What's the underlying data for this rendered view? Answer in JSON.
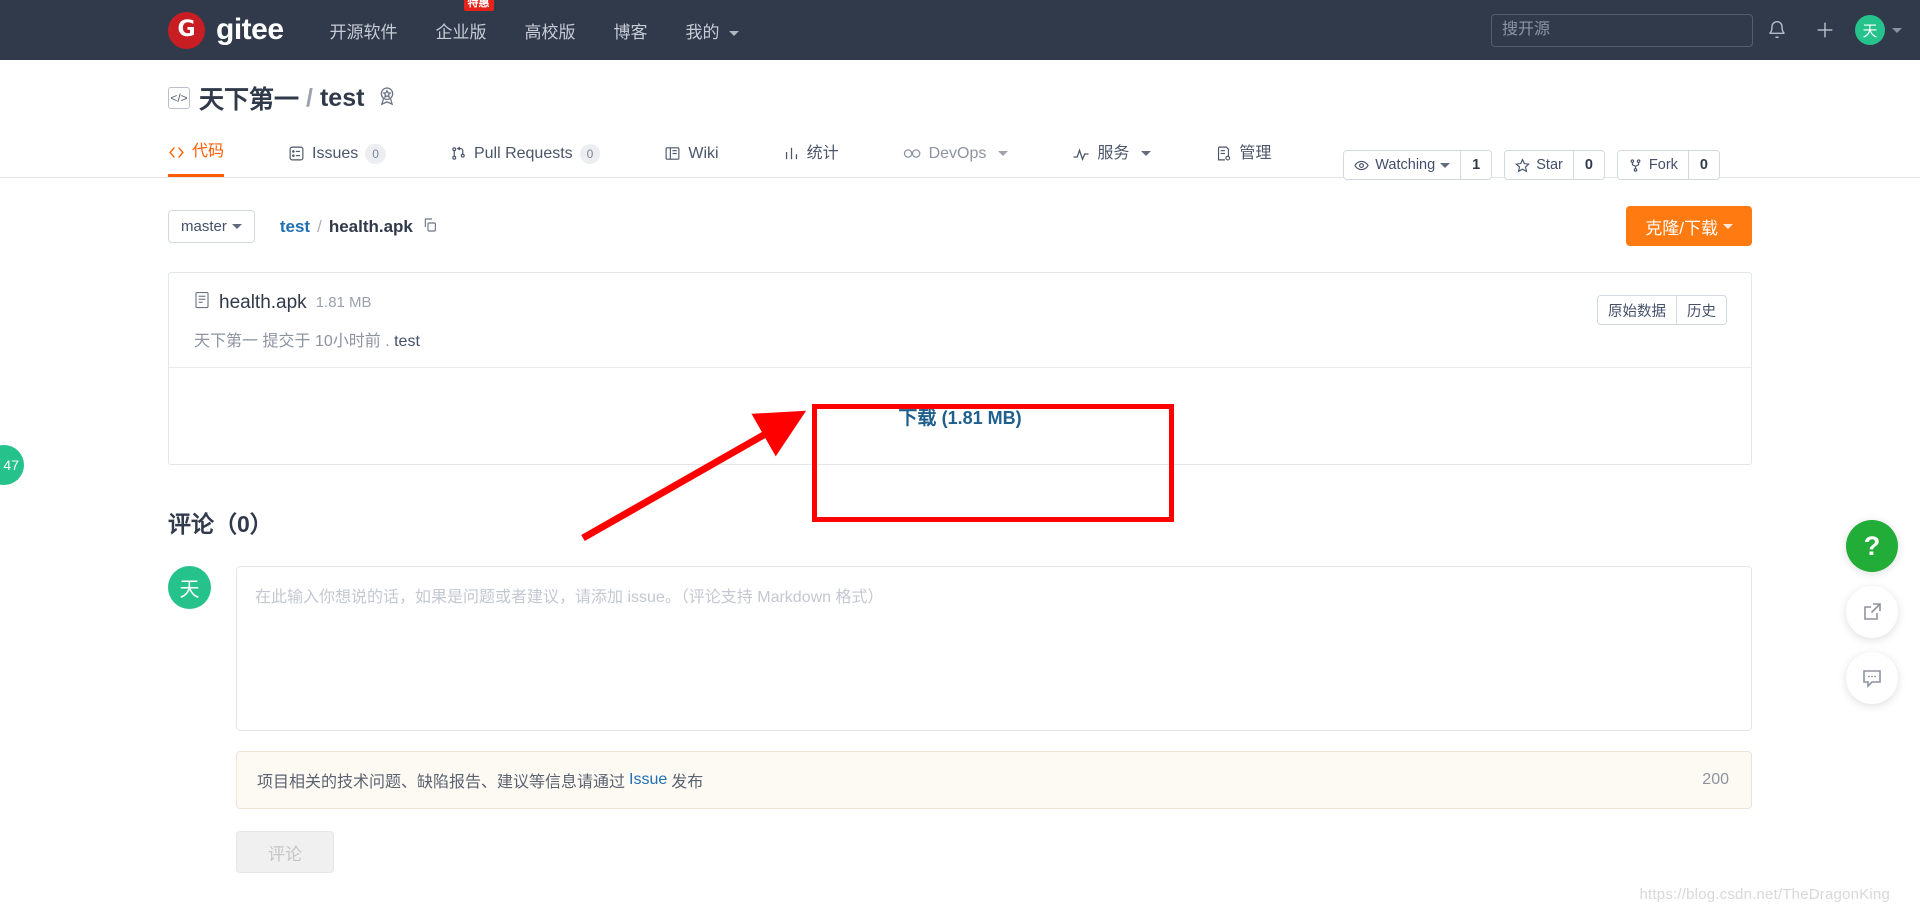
{
  "topnav": {
    "brand": "gitee",
    "brand_mark": "G",
    "links": [
      {
        "label": "开源软件",
        "badge": ""
      },
      {
        "label": "企业版",
        "badge": "特惠"
      },
      {
        "label": "高校版",
        "badge": ""
      },
      {
        "label": "博客",
        "badge": ""
      },
      {
        "label": "我的",
        "badge": "",
        "caret": true
      }
    ],
    "search_placeholder": "搜开源",
    "search_value": "",
    "bell_icon": "bell-icon",
    "plus_icon": "plus-icon",
    "avatar_initial": "天"
  },
  "repo": {
    "code_icon": "code-brackets-icon",
    "owner": "天下第一",
    "separator": "/",
    "name": "test",
    "medal_icon": "medal-star-icon",
    "actions": [
      {
        "icon": "eye-icon",
        "label": "Watching",
        "caret": true,
        "count": "1"
      },
      {
        "icon": "star-icon",
        "label": "Star",
        "caret": false,
        "count": "0"
      },
      {
        "icon": "fork-icon",
        "label": "Fork",
        "caret": false,
        "count": "0"
      }
    ]
  },
  "tabs": [
    {
      "icon": "code-icon",
      "label": "代码",
      "badge": "",
      "active": true,
      "caret": false,
      "muted": false
    },
    {
      "icon": "issues-icon",
      "label": "Issues",
      "badge": "0",
      "active": false,
      "caret": false,
      "muted": false
    },
    {
      "icon": "pull-request-icon",
      "label": "Pull Requests",
      "badge": "0",
      "active": false,
      "caret": false,
      "muted": false
    },
    {
      "icon": "wiki-icon",
      "label": "Wiki",
      "badge": "",
      "active": false,
      "caret": false,
      "muted": false
    },
    {
      "icon": "stats-icon",
      "label": "统计",
      "badge": "",
      "active": false,
      "caret": false,
      "muted": false
    },
    {
      "icon": "devops-icon",
      "label": "DevOps",
      "badge": "",
      "active": false,
      "caret": true,
      "muted": true
    },
    {
      "icon": "service-icon",
      "label": "服务",
      "badge": "",
      "active": false,
      "caret": true,
      "muted": false
    },
    {
      "icon": "manage-icon",
      "label": "管理",
      "badge": "",
      "active": false,
      "caret": false,
      "muted": false
    }
  ],
  "toolbar": {
    "branch": "master",
    "breadcrumb_repo": "test",
    "breadcrumb_sep": "/",
    "breadcrumb_file": "health.apk",
    "copy_icon": "copy-icon",
    "clone_label": "克隆/下载"
  },
  "file": {
    "file_icon": "file-icon",
    "name": "health.apk",
    "size": "1.81 MB",
    "commit_author": "天下第一",
    "commit_verb": "提交于",
    "commit_time": "10小时前",
    "commit_dot": ".",
    "commit_message": "test",
    "actions": [
      "原始数据",
      "历史"
    ],
    "download_label": "下载",
    "download_size": "(1.81 MB)"
  },
  "annotation": {
    "box_color": "#fe0000",
    "arrow_color": "#fe0000"
  },
  "comments": {
    "title": "评论（0）",
    "avatar_initial": "天",
    "input_placeholder": "在此输入你想说的话，如果是问题或者建议，请添加 issue。（评论支持 Markdown 格式）",
    "input_value": "",
    "notice_prefix": "项目相关的技术问题、缺陷报告、建议等信息请通过",
    "notice_link": "Issue",
    "notice_suffix": "发布",
    "notice_count": "200",
    "submit_label": "评论"
  },
  "floaters": [
    {
      "icon": "help-question-icon",
      "label": "?"
    },
    {
      "icon": "share-external-icon",
      "label": ""
    },
    {
      "icon": "feedback-chat-icon",
      "label": ""
    }
  ],
  "left_badge": "47",
  "watermark": "https://blog.csdn.net/TheDragonKing"
}
